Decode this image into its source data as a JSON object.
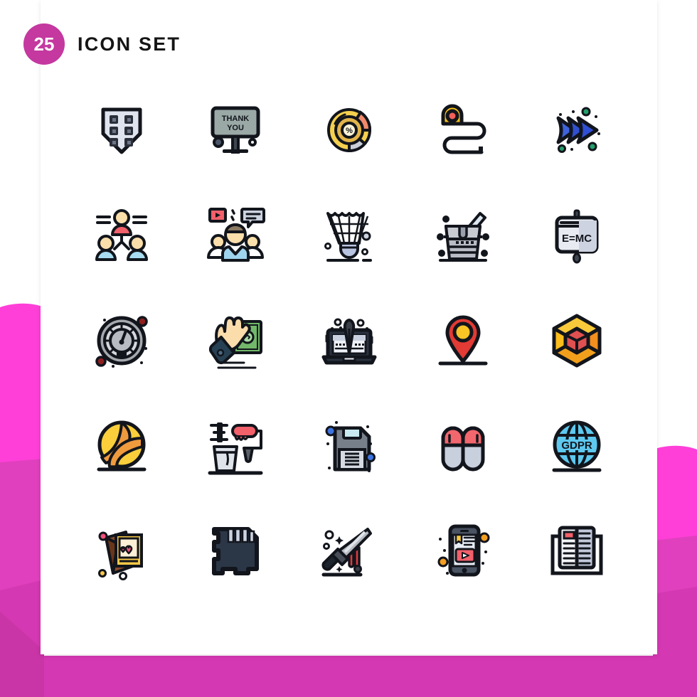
{
  "page": {
    "background_color": "#ffffff",
    "card_color": "#ffffff",
    "accent_pink": "#ff3fd8",
    "accent_pink_dark": "#cd37ac",
    "badge_color": "#c4389f"
  },
  "header": {
    "badge_count": "25",
    "title": "ICON SET"
  },
  "icons": [
    {
      "id": 1,
      "name": "shield-grid-icon",
      "label": "Shield with grid",
      "text": ""
    },
    {
      "id": 2,
      "name": "thank-you-billboard-icon",
      "label": "Thank You billboard sign",
      "text": "THANK\nYOU"
    },
    {
      "id": 3,
      "name": "discount-pie-chart-icon",
      "label": "Percent pie chart coin",
      "text": "%"
    },
    {
      "id": 4,
      "name": "measuring-tape-icon",
      "label": "Measuring tape",
      "text": ""
    },
    {
      "id": 5,
      "name": "fast-forward-arrows-icon",
      "label": "Triple forward arrows",
      "text": ""
    },
    {
      "id": 6,
      "name": "team-hierarchy-icon",
      "label": "Team group hierarchy",
      "text": ""
    },
    {
      "id": 7,
      "name": "video-chat-team-icon",
      "label": "Team video chat",
      "text": ""
    },
    {
      "id": 8,
      "name": "shuttlecock-icon",
      "label": "Badminton shuttlecock",
      "text": ""
    },
    {
      "id": 9,
      "name": "champagne-bucket-icon",
      "label": "Champagne ice bucket",
      "text": ""
    },
    {
      "id": 10,
      "name": "presentation-board-icon",
      "label": "Presentation board E=MC",
      "text": "E=MC"
    },
    {
      "id": 11,
      "name": "speedometer-icon",
      "label": "Speedometer gauge",
      "text": ""
    },
    {
      "id": 12,
      "name": "cash-payment-hand-icon",
      "label": "Hand holding banknote",
      "text": ""
    },
    {
      "id": 13,
      "name": "laptop-pen-icon",
      "label": "Laptop with pen",
      "text": ""
    },
    {
      "id": 14,
      "name": "map-pin-icon",
      "label": "Location map pin",
      "text": ""
    },
    {
      "id": 15,
      "name": "cube-3d-icon",
      "label": "3D wireframe cube",
      "text": ""
    },
    {
      "id": 16,
      "name": "volleyball-icon",
      "label": "Volleyball",
      "text": ""
    },
    {
      "id": 17,
      "name": "paint-roller-bucket-icon",
      "label": "Paint roller and bucket",
      "text": ""
    },
    {
      "id": 18,
      "name": "floppy-disk-icon",
      "label": "Floppy disk save",
      "text": ""
    },
    {
      "id": 19,
      "name": "slippers-icon",
      "label": "Pair of slippers",
      "text": ""
    },
    {
      "id": 20,
      "name": "gdpr-globe-icon",
      "label": "GDPR globe",
      "text": "GDPR"
    },
    {
      "id": 21,
      "name": "love-photos-icon",
      "label": "Photos with hearts",
      "text": ""
    },
    {
      "id": 22,
      "name": "sd-memory-card-icon",
      "label": "SD memory card",
      "text": ""
    },
    {
      "id": 23,
      "name": "bloody-knife-icon",
      "label": "Knife with blood",
      "text": ""
    },
    {
      "id": 24,
      "name": "mobile-video-icon",
      "label": "Mobile video player",
      "text": ""
    },
    {
      "id": 25,
      "name": "newspaper-icon",
      "label": "Newspaper",
      "text": ""
    }
  ]
}
